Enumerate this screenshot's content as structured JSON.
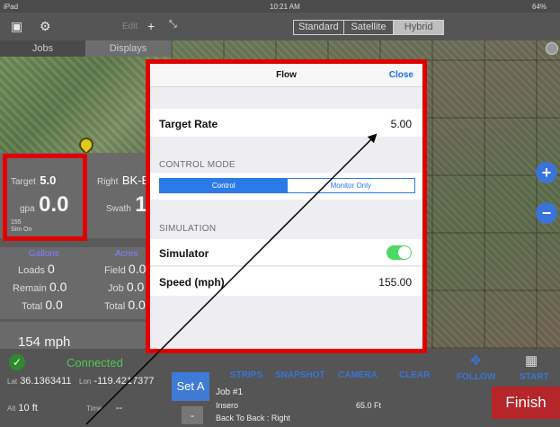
{
  "status_bar": {
    "device": "iPad",
    "time": "10:21 AM",
    "battery": "64%"
  },
  "toolbar": {
    "edit_label": "Edit",
    "map_types": [
      "Standard",
      "Satellite",
      "Hybrid"
    ]
  },
  "left_tabs": [
    "Jobs",
    "Displays"
  ],
  "metrics": {
    "target_label": "Target",
    "target_value": "5.0",
    "gpa_label": "gpa",
    "gpa_value": "0.0",
    "sim_speed": "155",
    "sim_status": "Sim On",
    "right_label": "Right",
    "right_value": "BK-E",
    "swath_label": "Swath",
    "swath_value": "1"
  },
  "totals": {
    "gallons_header": "Gallons",
    "acres_header": "Acres",
    "loads_label": "Loads",
    "loads_value": "0",
    "remain_label": "Remain",
    "remain_value": "0.0",
    "total_label": "Total",
    "total_value": "0.0",
    "field_label": "Field",
    "field_value": "0.0",
    "job_label": "Job",
    "job_value": "0.0",
    "acres_total_label": "Total",
    "acres_total_value": "0.0"
  },
  "speed_display": "154 mph",
  "bottom": {
    "connected": "Connected",
    "lat_label": "Lat",
    "lat_value": "36.1363411",
    "lon_label": "Lon",
    "lon_value": "-119.4217377",
    "alt_label": "Alt",
    "alt_value": "10 ft",
    "time_label": "Time",
    "time_value": "--",
    "set_a": "Set A",
    "minus": "-",
    "job_name": "Job #1",
    "operator": "Insero",
    "distance": "65.0 Ft",
    "pattern": "Back To Back : Right",
    "strips": "STRIPS",
    "snapshot": "SNAPSHOT",
    "camera": "CAMERA",
    "clear": "CLEAR",
    "follow": "FOLLOW",
    "start": "START",
    "finish": "Finish"
  },
  "map_buttons": {
    "zoom_in": "+",
    "zoom_out": "−"
  },
  "modal": {
    "title": "Flow",
    "close": "Close",
    "target_rate_label": "Target Rate",
    "target_rate_value": "5.00",
    "control_mode_header": "CONTROL MODE",
    "control_mode_options": [
      "Control",
      "Monitor Only"
    ],
    "control_mode_selected": "Control",
    "simulation_header": "SIMULATION",
    "simulator_label": "Simulator",
    "simulator_on": true,
    "speed_label": "Speed (mph)",
    "speed_value": "155.00"
  },
  "colors": {
    "highlight": "#e10000",
    "accent_blue": "#2a7be8",
    "toggle_green": "#4cd964",
    "finish_red": "#b5252a"
  }
}
